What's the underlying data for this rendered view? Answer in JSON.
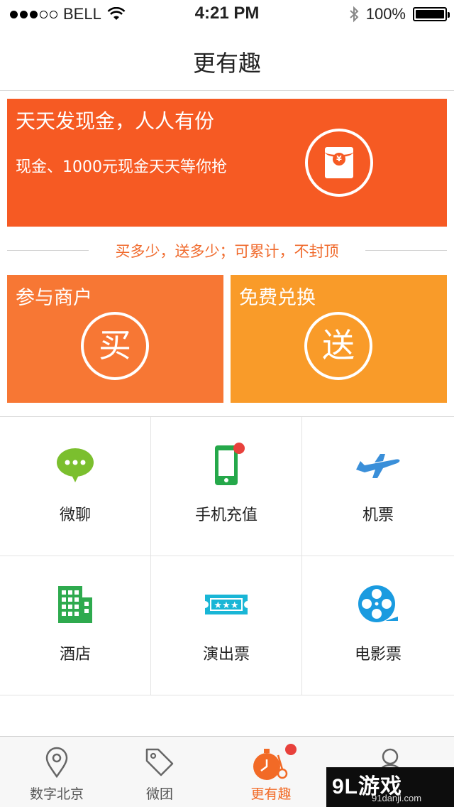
{
  "status_bar": {
    "carrier": "BELL",
    "time": "4:21 PM",
    "battery": "100%",
    "signal_bars_filled": 3,
    "signal_bars_total": 5
  },
  "nav": {
    "title": "更有趣"
  },
  "banner": {
    "title": "天天发现金，人人有份",
    "subtitle": "现金、1000元现金天天等你抢",
    "icon": "red-envelope-icon",
    "coin_glyph": "¥",
    "color": "#f65a23"
  },
  "slogan": "买多少，送多少；可累计，不封顶",
  "tiles": [
    {
      "title": "参与商户",
      "glyph": "买",
      "color": "#f77734"
    },
    {
      "title": "免费兑换",
      "glyph": "送",
      "color": "#f99b29"
    }
  ],
  "services": [
    {
      "label": "微聊",
      "icon": "chat-bubble-icon",
      "color": "#7bbf2e",
      "badge": false
    },
    {
      "label": "手机充值",
      "icon": "mobile-phone-icon",
      "color": "#25a84a",
      "badge": true
    },
    {
      "label": "机票",
      "icon": "airplane-icon",
      "color": "#3a8fd9",
      "badge": false
    },
    {
      "label": "酒店",
      "icon": "hotel-building-icon",
      "color": "#2eaa4e",
      "badge": false
    },
    {
      "label": "演出票",
      "icon": "ticket-icon",
      "color": "#19b6d6",
      "badge": false
    },
    {
      "label": "电影票",
      "icon": "film-reel-icon",
      "color": "#1a9be0",
      "badge": false
    }
  ],
  "tabbar": [
    {
      "label": "数字北京",
      "icon": "location-pin-icon",
      "active": false
    },
    {
      "label": "微团",
      "icon": "price-tag-icon",
      "active": false
    },
    {
      "label": "更有趣",
      "icon": "stopwatch-icon",
      "active": true,
      "badge": true
    },
    {
      "label": "",
      "icon": "user-icon",
      "active": false
    }
  ],
  "watermark": {
    "main": "9L游戏",
    "sub": "91danji.com"
  },
  "accent_color": "#f26a26"
}
